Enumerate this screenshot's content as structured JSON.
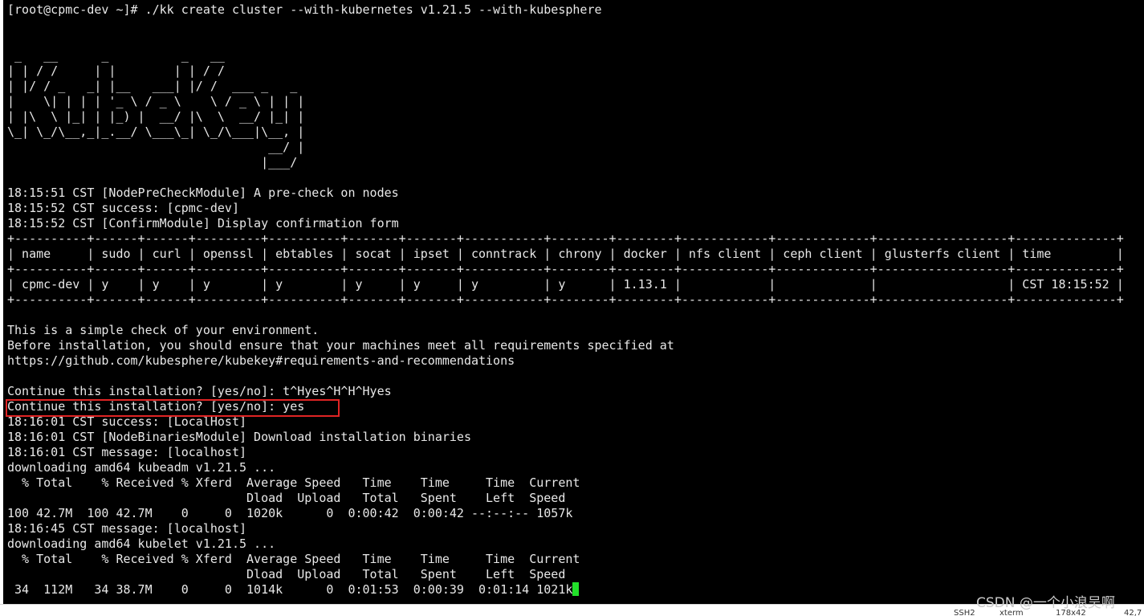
{
  "terminal": {
    "lines": [
      "[root@cpmc-dev ~]# ./kk create cluster --with-kubernetes v1.21.5 --with-kubesphere",
      "",
      "",
      " _   __      _          _   __",
      "| | / /     | |        | | / /",
      "| |/ / _   _| |__   ___| |/ /  ___ _   _",
      "|    \\| | | | '_ \\ / _ \\    \\ / _ \\ | | |",
      "| |\\  \\ |_| | |_) |  __/ |\\  \\  __/ |_| |",
      "\\_| \\_/\\__,_|_.__/ \\___\\_| \\_/\\___|\\__, |",
      "                                    __/ |",
      "                                   |___/",
      "",
      "18:15:51 CST [NodePreCheckModule] A pre-check on nodes",
      "18:15:52 CST success: [cpmc-dev]",
      "18:15:52 CST [ConfirmModule] Display confirmation form",
      "+----------+------+------+---------+----------+-------+-------+-----------+--------+--------+------------+-------------+------------------+--------------+",
      "| name     | sudo | curl | openssl | ebtables | socat | ipset | conntrack | chrony | docker | nfs client | ceph client | glusterfs client | time         |",
      "+----------+------+------+---------+----------+-------+-------+-----------+--------+--------+------------+-------------+------------------+--------------+",
      "| cpmc-dev | y    | y    | y       | y        | y     | y     | y         | y      | 1.13.1 |            |             |                  | CST 18:15:52 |",
      "+----------+------+------+---------+----------+-------+-------+-----------+--------+--------+------------+-------------+------------------+--------------+",
      "",
      "This is a simple check of your environment.",
      "Before installation, you should ensure that your machines meet all requirements specified at",
      "https://github.com/kubesphere/kubekey#requirements-and-recommendations",
      "",
      "Continue this installation? [yes/no]: t^Hyes^H^H^Hyes",
      "Continue this installation? [yes/no]: yes",
      "18:16:01 CST success: [LocalHost]",
      "18:16:01 CST [NodeBinariesModule] Download installation binaries",
      "18:16:01 CST message: [localhost]",
      "downloading amd64 kubeadm v1.21.5 ...",
      "  % Total    % Received % Xferd  Average Speed   Time    Time     Time  Current",
      "                                 Dload  Upload   Total   Spent    Left  Speed",
      "100 42.7M  100 42.7M    0     0  1020k      0  0:00:42  0:00:42 --:--:-- 1057k",
      "18:16:45 CST message: [localhost]",
      "downloading amd64 kubelet v1.21.5 ...",
      "  % Total    % Received % Xferd  Average Speed   Time    Time     Time  Current",
      "                                 Dload  Upload   Total   Spent    Left  Speed",
      " 34  112M   34 38.7M    0     0  1014k      0  0:01:53  0:00:39  0:01:14 1021k"
    ],
    "cursor_color": "#22e02a",
    "highlight_color": "#e02424"
  },
  "status_bar": {
    "items": [
      "SSH2",
      "xterm",
      "178x42",
      "42,7"
    ]
  },
  "watermark": "CSDN @一个小浪吴啊"
}
